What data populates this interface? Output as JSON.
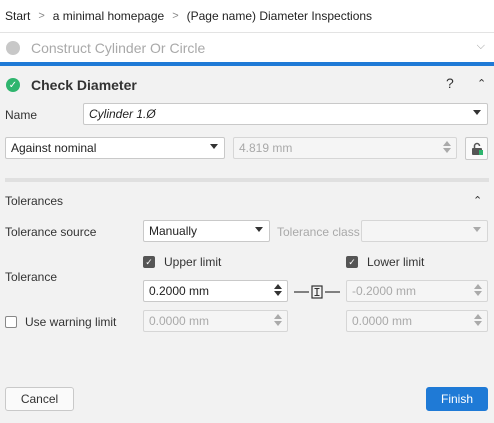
{
  "breadcrumb": [
    "Start",
    "a minimal homepage",
    "(Page name) Diameter Inspections"
  ],
  "steps": {
    "construct": "Construct Cylinder Or Circle",
    "check": "Check Diameter",
    "help": "?"
  },
  "form": {
    "name_label": "Name",
    "name_value": "Cylinder 1.Ø",
    "mode_value": "Against nominal",
    "nominal_value": "4.819 mm"
  },
  "tolerances": {
    "title": "Tolerances",
    "source_label": "Tolerance source",
    "source_value": "Manually",
    "class_label": "Tolerance class",
    "class_value": "",
    "tolerance_label": "Tolerance",
    "upper_label": "Upper limit",
    "upper_checked": true,
    "lower_label": "Lower limit",
    "lower_checked": true,
    "upper_value": "0.2000 mm",
    "lower_value": "-0.2000 mm",
    "warning_label": "Use warning limit",
    "warning_checked": false,
    "warning_upper": "0.0000 mm",
    "warning_lower": "0.0000 mm"
  },
  "buttons": {
    "cancel": "Cancel",
    "finish": "Finish"
  },
  "colors": {
    "accent": "#1f7ad6",
    "success": "#2fb56e"
  },
  "icons": [
    "chevron-down-icon",
    "chevron-up-icon",
    "check-icon",
    "help-icon",
    "lock-icon",
    "symmetric-link-icon"
  ]
}
